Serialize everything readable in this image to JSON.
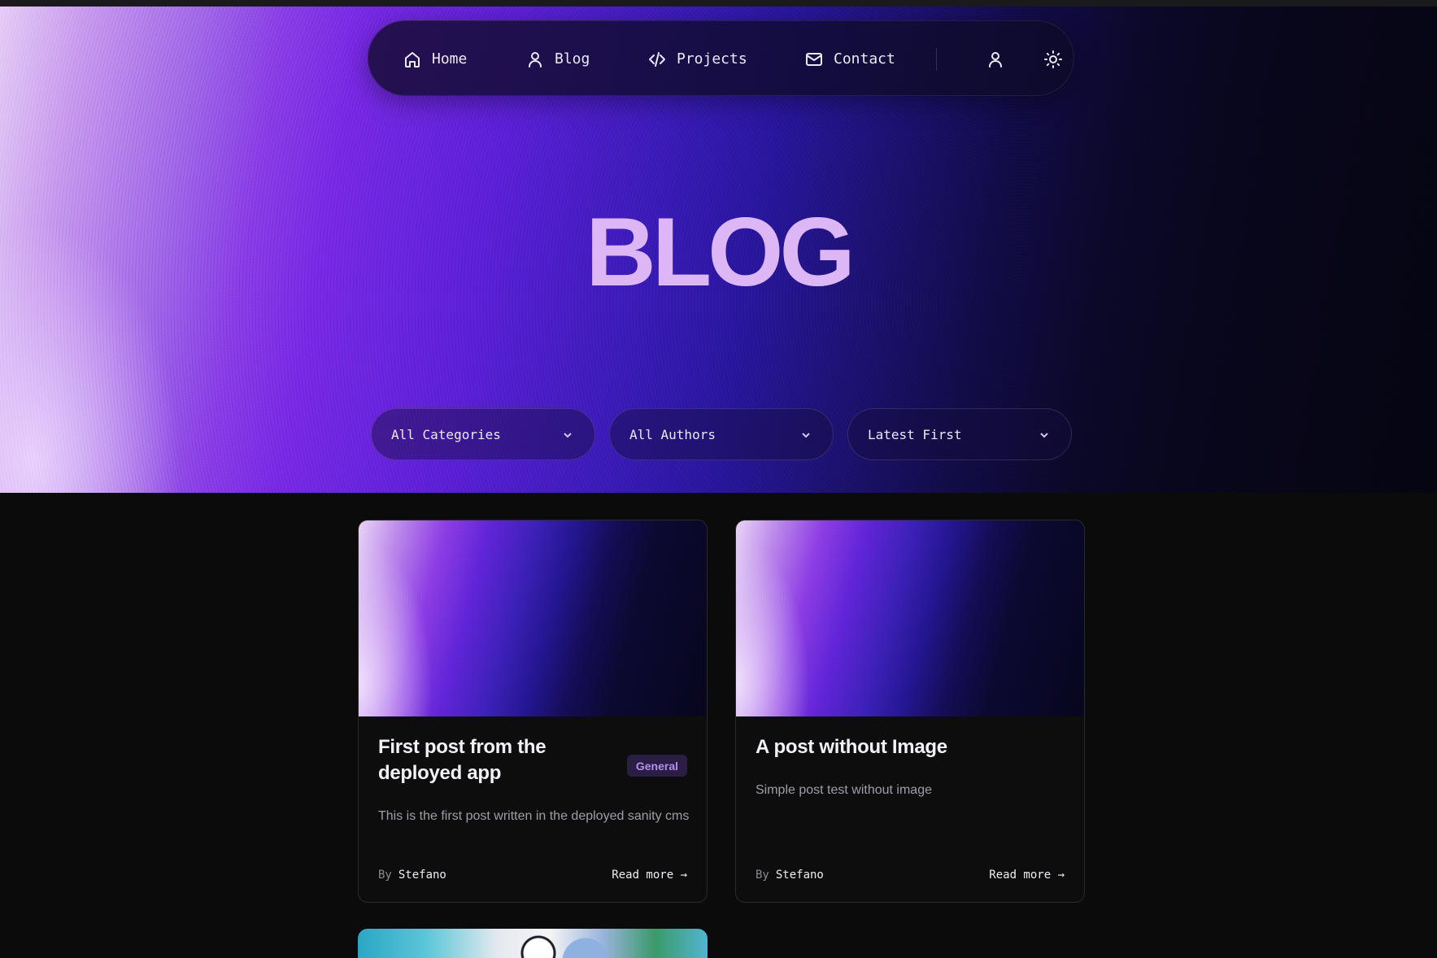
{
  "nav": {
    "items": [
      {
        "label": "Home",
        "icon": "home-icon"
      },
      {
        "label": "Blog",
        "icon": "user-icon"
      },
      {
        "label": "Projects",
        "icon": "code-icon"
      },
      {
        "label": "Contact",
        "icon": "mail-icon"
      }
    ],
    "account_icon": "user-icon",
    "theme_icon": "sun-icon"
  },
  "hero": {
    "title": "BLOG"
  },
  "filters": {
    "category": "All Categories",
    "author": "All Authors",
    "sort": "Latest First"
  },
  "posts": [
    {
      "title": "First post from the deployed app",
      "badge": "General",
      "description": "This is the first post written in the deployed sanity cms",
      "by": "By",
      "author": "Stefano",
      "read_more": "Read more →"
    },
    {
      "title": "A post without Image",
      "description": "Simple post test without image",
      "by": "By",
      "author": "Stefano",
      "read_more": "Read more →"
    }
  ],
  "colors": {
    "accent": "#ddb6f6",
    "badge_bg": "#2a1e44",
    "badge_text": "#b78cf2",
    "page_bg": "#0b0b0b"
  }
}
